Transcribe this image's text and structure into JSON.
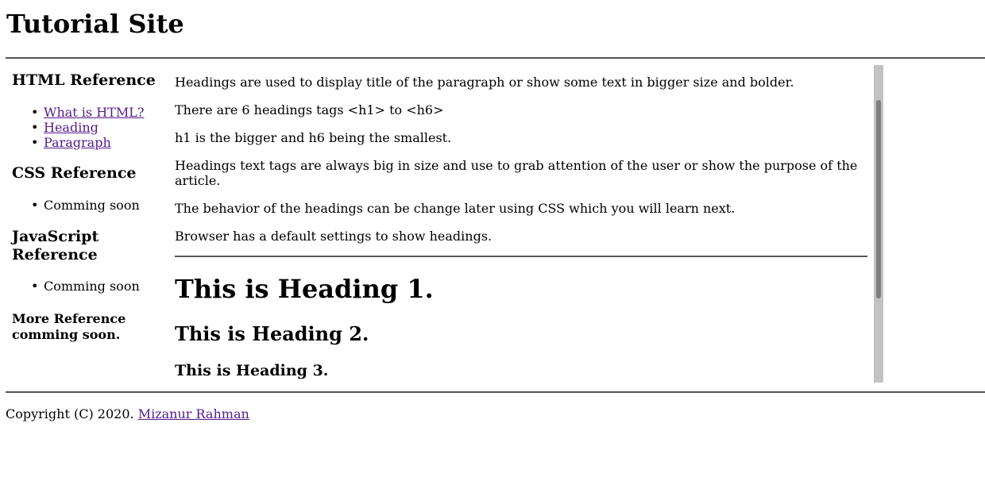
{
  "header": {
    "title": "Tutorial Site"
  },
  "sidebar": {
    "sections": [
      {
        "heading": "HTML Reference",
        "items": [
          "What is HTML?",
          "Heading",
          "Paragraph"
        ]
      },
      {
        "heading": "CSS Reference",
        "items": [
          "Comming soon"
        ]
      },
      {
        "heading": "JavaScript Reference",
        "items": [
          "Comming soon"
        ]
      }
    ],
    "more": "More Reference comming soon."
  },
  "main": {
    "paragraphs": [
      "Headings are used to display title of the paragraph or show some text in bigger size and bolder.",
      "There are 6 headings tags <h1> to <h6>",
      "h1 is the bigger and h6 being the smallest.",
      "Headings text tags are always big in size and use to grab attention of the user or show the purpose of the article.",
      "The behavior of the headings can be change later using CSS which you will learn next.",
      "Browser has a default settings to show headings."
    ],
    "demo_headings": [
      "This is Heading 1.",
      "This is Heading 2.",
      "This is Heading 3."
    ]
  },
  "footer": {
    "copyright": "Copyright (C) 2020.",
    "author": "Mizanur Rahman"
  },
  "colors": {
    "link": "#551a8b",
    "rule": "#555555",
    "scroll_track": "#c2c2c2",
    "scroll_thumb": "#7e7e7e"
  }
}
